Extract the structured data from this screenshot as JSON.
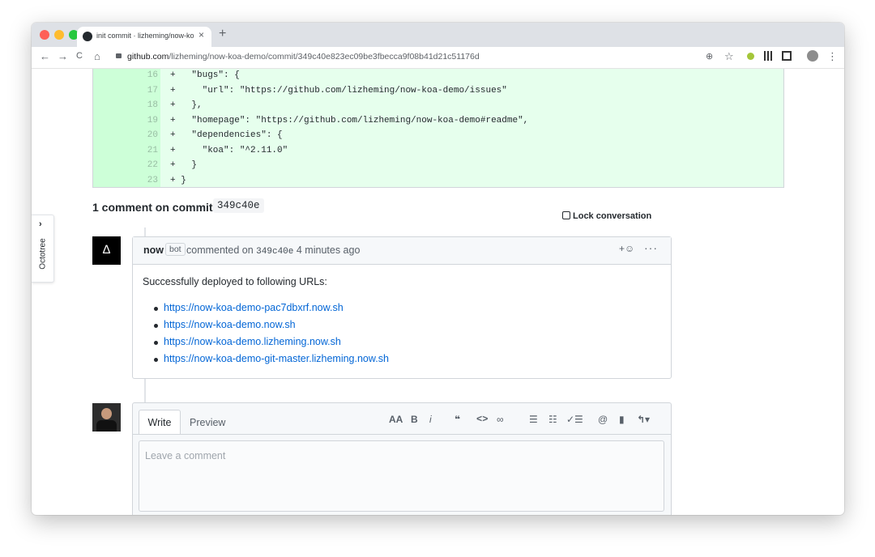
{
  "browser": {
    "tab_title": "init commit · lizheming/now-koa-demo",
    "tab_close": "×",
    "new_tab": "+",
    "url_host": "github.com",
    "url_path": "/lizheming/now-koa-demo/commit/349c40e823ec09be3fbecca9f08b41d21c51176d",
    "back": "←",
    "forward": "→",
    "reload": "C",
    "home": "⌂",
    "zoom": "⊕",
    "star": "☆",
    "menu": "⋮"
  },
  "diff": {
    "lines": [
      {
        "num": "16",
        "code": "+   \"bugs\": {"
      },
      {
        "num": "17",
        "code": "+     \"url\": \"https://github.com/lizheming/now-koa-demo/issues\""
      },
      {
        "num": "18",
        "code": "+   },"
      },
      {
        "num": "19",
        "code": "+   \"homepage\": \"https://github.com/lizheming/now-koa-demo#readme\","
      },
      {
        "num": "20",
        "code": "+   \"dependencies\": {"
      },
      {
        "num": "21",
        "code": "+     \"koa\": \"^2.11.0\""
      },
      {
        "num": "22",
        "code": "+   }"
      },
      {
        "num": "23",
        "code": "+ }"
      }
    ]
  },
  "conversation": {
    "header": "1 comment on commit",
    "sha": "349c40e",
    "lock_label": "Lock conversation"
  },
  "comment": {
    "avatar_glyph": "∆",
    "author": "now",
    "badge": "bot",
    "commented_on": "commented on",
    "sha": "349c40e",
    "time": "4 minutes ago",
    "reaction": "+☺",
    "more": "···",
    "body": "Successfully deployed to following URLs:",
    "urls": [
      "https://now-koa-demo-pac7dbxrf.now.sh",
      "https://now-koa-demo.now.sh",
      "https://now-koa-demo.lizheming.now.sh",
      "https://now-koa-demo-git-master.lizheming.now.sh"
    ]
  },
  "editor": {
    "tab_write": "Write",
    "tab_preview": "Preview",
    "placeholder": "Leave a comment",
    "tools": {
      "heading": "AA",
      "bold": "B",
      "italic": "i",
      "quote": "❝",
      "code": "<>",
      "link": "∞",
      "bullets": "☰",
      "numbered": "☷",
      "tasks": "✓☰",
      "mention": "@",
      "saved": "▮",
      "reply": "↰▾"
    }
  },
  "octotree": {
    "label": "Octotree",
    "chevron": "›"
  }
}
